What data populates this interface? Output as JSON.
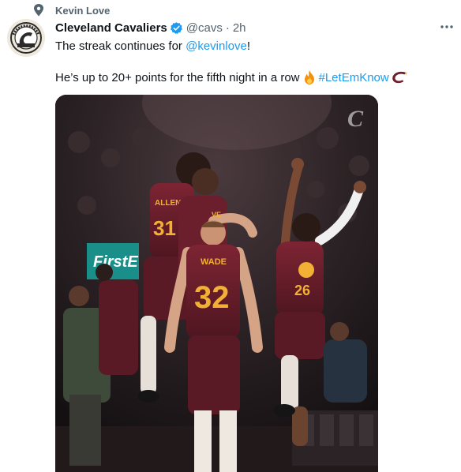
{
  "context": {
    "text": "Kevin Love",
    "icon": "pin-icon"
  },
  "author": {
    "name": "Cleveland Cavaliers",
    "verified_icon": "verified-badge-icon",
    "handle": "@cavs",
    "separator": "·",
    "time": "2h",
    "avatar_icon": "cavs-logo-avatar"
  },
  "tweet": {
    "line1_before": "The streak continues for ",
    "mention": "@kevinlove",
    "line1_after": "!",
    "line2_text": "He’s up to 20+ points for the fifth night in a row",
    "hashtag": "#LetEmKnow",
    "emoji_icon": "fire-emoji-icon",
    "brand_icon": "cavs-c-logo-icon"
  },
  "media": {
    "alt_icon": "team-celebration-photo",
    "jersey_left": "ALLEN",
    "jersey_number_left": "31",
    "jersey_center_name": "WADE",
    "jersey_center_number": "32",
    "jersey_right_number": "26",
    "sign_text": "FirstE",
    "watermark": "C"
  },
  "colors": {
    "accent": "#1d9bf0",
    "wine": "#6f1f2c",
    "gold": "#f2b134",
    "text_secondary": "#536471"
  }
}
